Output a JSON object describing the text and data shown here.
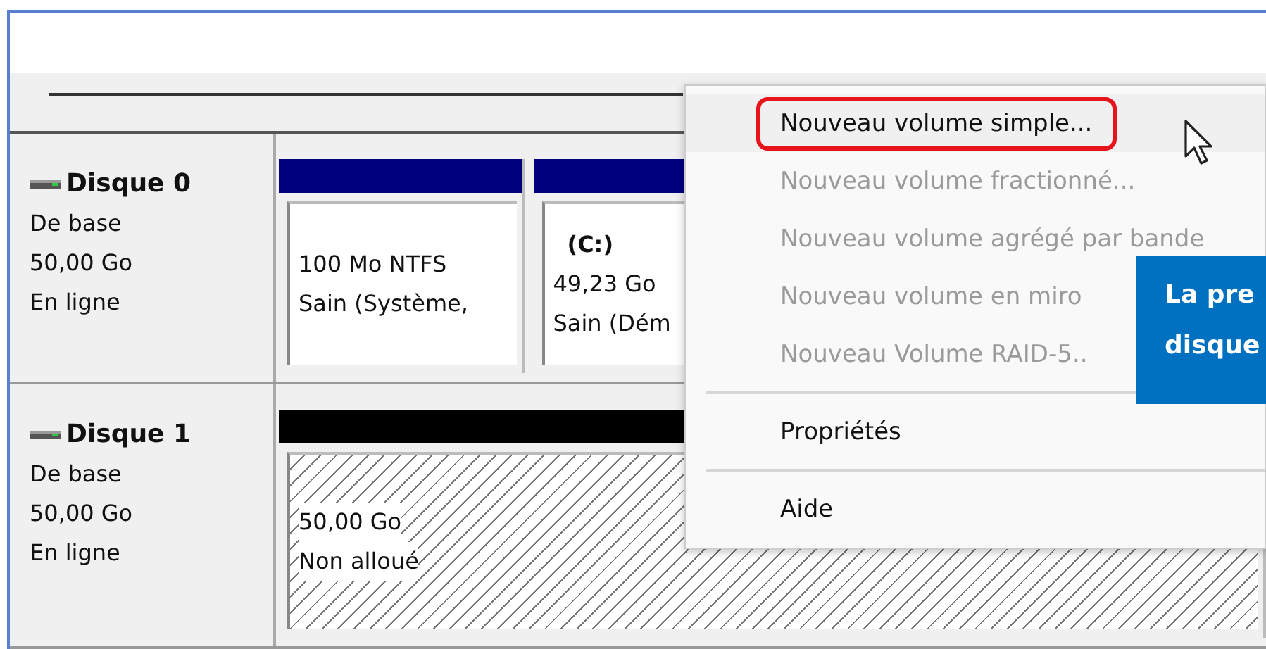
{
  "disks": [
    {
      "name": "Disque 0",
      "type": "De base",
      "size": "50,00 Go",
      "status": "En ligne",
      "partitions": [
        {
          "kind": "primary",
          "color": "#00007f",
          "size": "100 Mo NTFS",
          "health": "Sain (Système,"
        },
        {
          "kind": "primary",
          "color": "#00007f",
          "label": "(C:)",
          "size": "49,23 Go",
          "health": "Sain (Dém"
        }
      ]
    },
    {
      "name": "Disque 1",
      "type": "De base",
      "size": "50,00 Go",
      "status": "En ligne",
      "partitions": [
        {
          "kind": "unallocated",
          "color": "#000000",
          "size": "50,00 Go",
          "health": "Non alloué"
        }
      ]
    }
  ],
  "context_menu": {
    "groups": [
      [
        {
          "label": "Nouveau volume simple...",
          "disabled": false,
          "selected": true
        },
        {
          "label": "Nouveau volume fractionné...",
          "disabled": true,
          "selected": false
        },
        {
          "label": "Nouveau volume agrégé par bande",
          "disabled": true,
          "selected": false
        },
        {
          "label": "Nouveau volume en miro",
          "disabled": true,
          "selected": false
        },
        {
          "label": "Nouveau Volume RAID-5..",
          "disabled": true,
          "selected": false
        }
      ],
      [
        {
          "label": "Propriétés",
          "disabled": false,
          "selected": false
        }
      ],
      [
        {
          "label": "Aide",
          "disabled": false,
          "selected": false
        }
      ]
    ]
  },
  "callout": {
    "lines": [
      "La pre",
      "disque"
    ]
  }
}
